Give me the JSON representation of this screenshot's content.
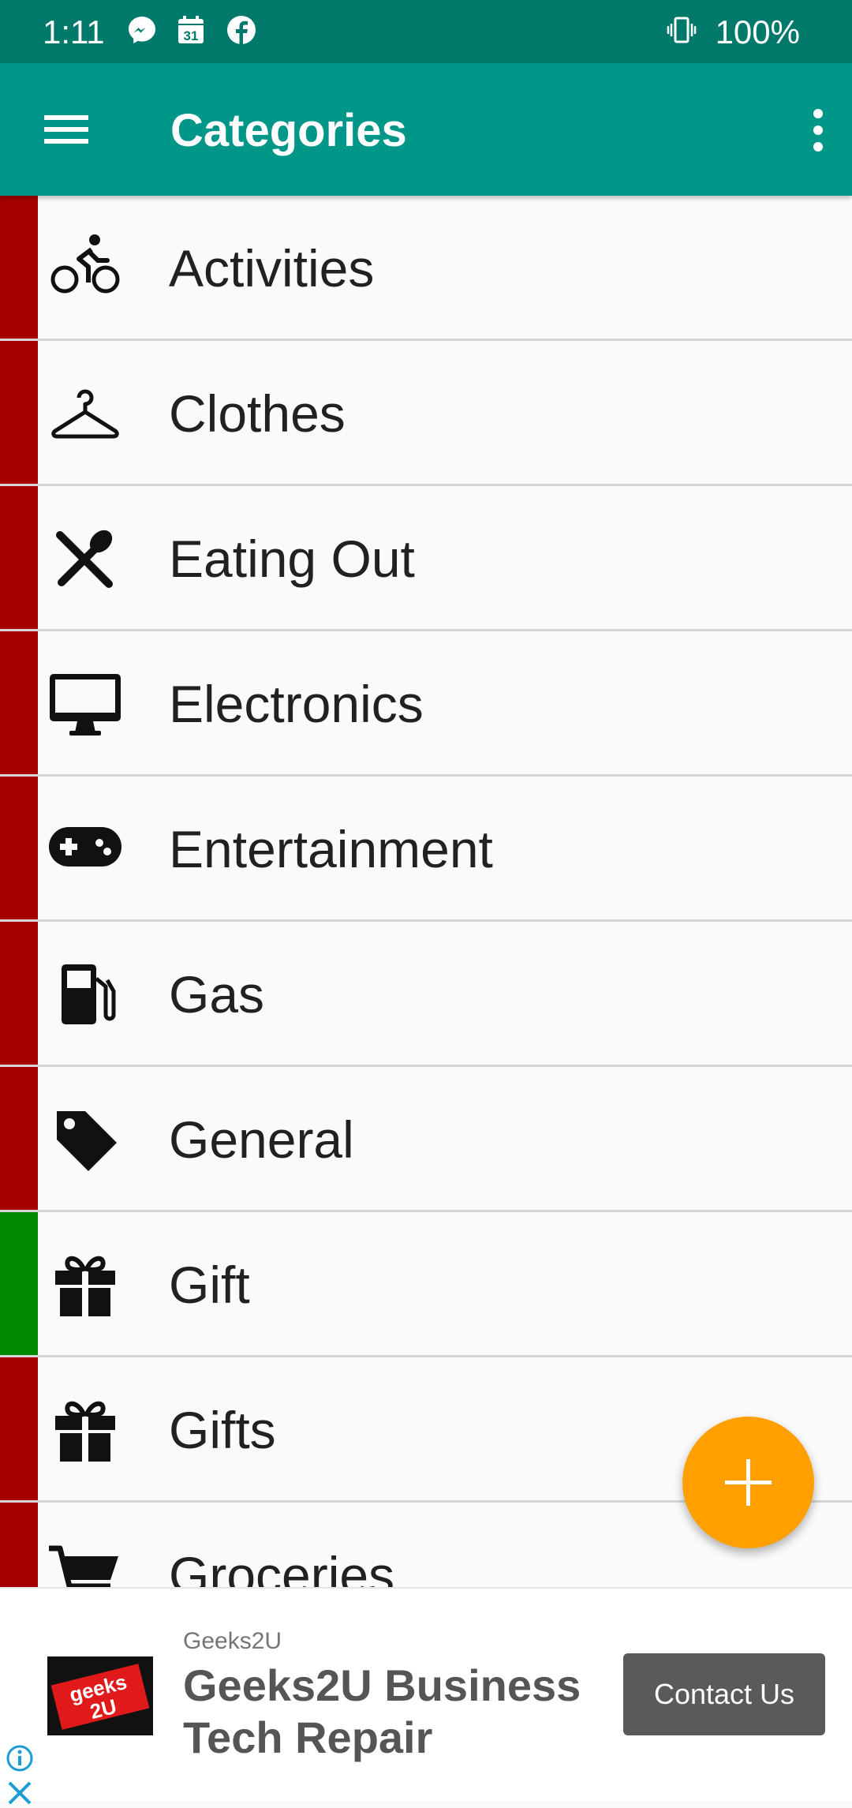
{
  "status_bar": {
    "time": "1:11",
    "battery": "100%",
    "icons": [
      "messenger-icon",
      "calendar-icon",
      "facebook-icon",
      "vibrate-icon"
    ],
    "calendar_day": "31"
  },
  "app_bar": {
    "title": "Categories",
    "color": "#009688",
    "status_color": "#00796b"
  },
  "categories": [
    {
      "label": "Activities",
      "icon": "bike-icon",
      "color": "#a50000"
    },
    {
      "label": "Clothes",
      "icon": "hanger-icon",
      "color": "#a50000"
    },
    {
      "label": "Eating Out",
      "icon": "utensils-icon",
      "color": "#a50000"
    },
    {
      "label": "Electronics",
      "icon": "monitor-icon",
      "color": "#a50000"
    },
    {
      "label": "Entertainment",
      "icon": "gamepad-icon",
      "color": "#a50000"
    },
    {
      "label": "Gas",
      "icon": "gas-pump-icon",
      "color": "#a50000"
    },
    {
      "label": "General",
      "icon": "tag-icon",
      "color": "#a50000"
    },
    {
      "label": "Gift",
      "icon": "gift-icon",
      "color": "#008a00"
    },
    {
      "label": "Gifts",
      "icon": "gift-icon",
      "color": "#a50000"
    },
    {
      "label": "Groceries",
      "icon": "cart-icon",
      "color": "#a50000"
    }
  ],
  "fab": {
    "icon": "plus-icon",
    "color": "#ffa000"
  },
  "ad": {
    "advertiser": "Geeks2U",
    "headline": "Geeks2U Business Tech Repair",
    "cta": "Contact Us",
    "logo_text": "geeks 2U"
  }
}
